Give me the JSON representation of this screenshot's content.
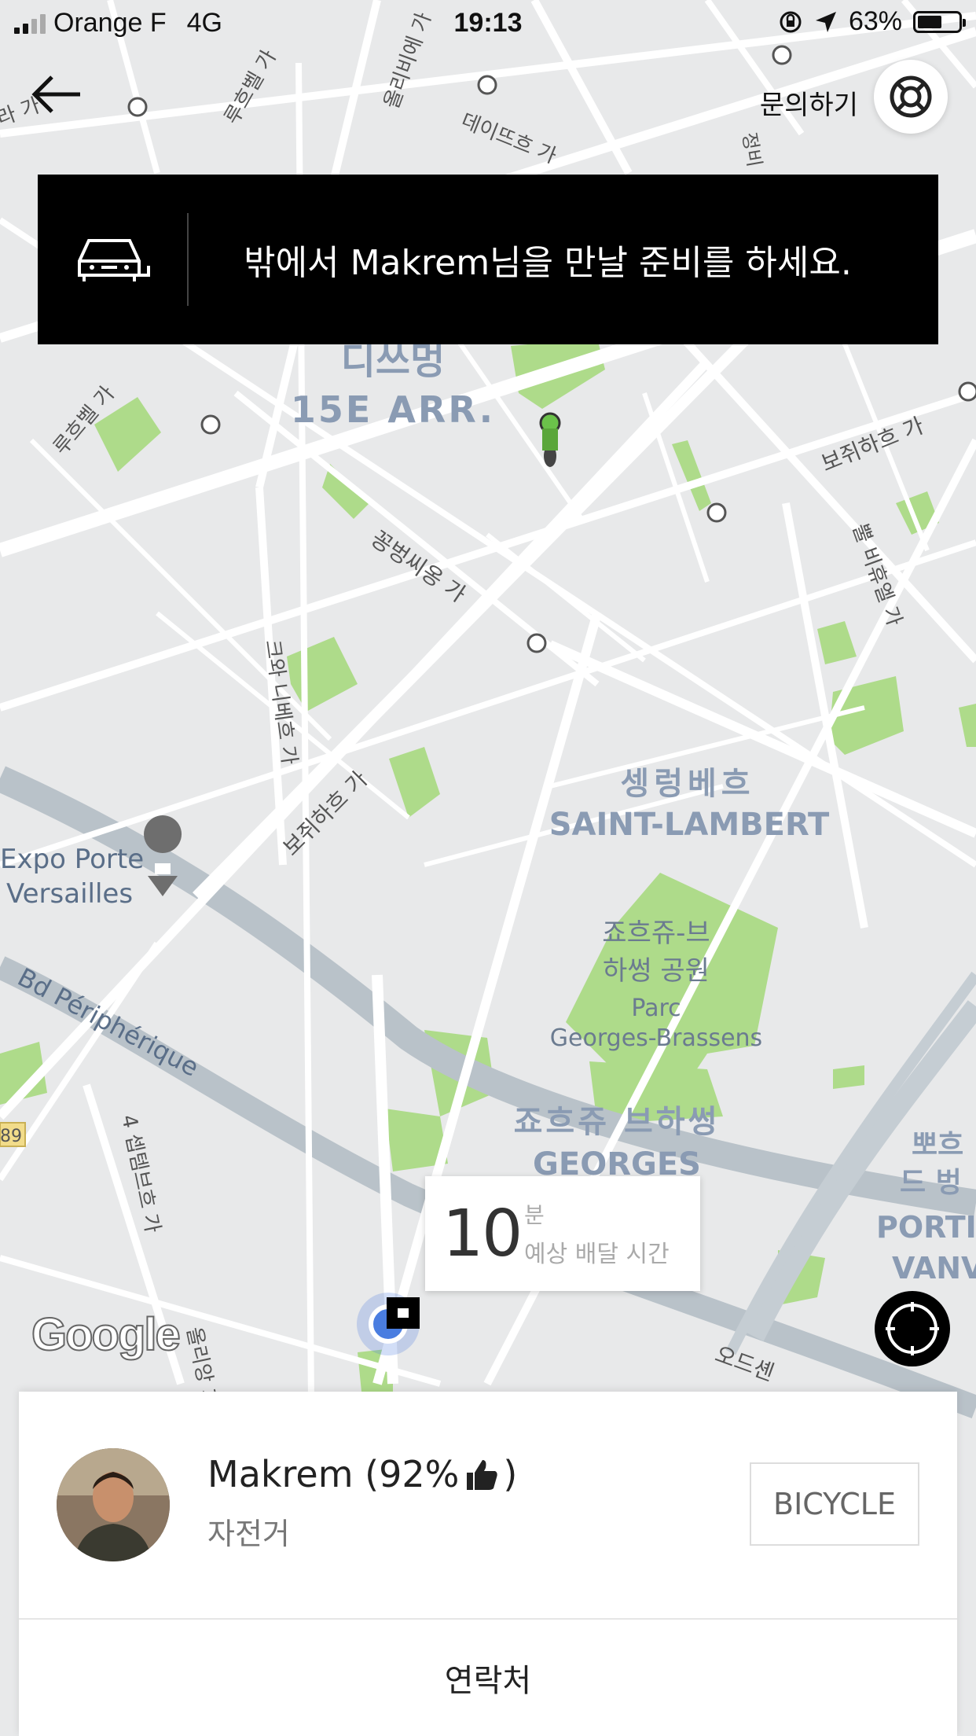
{
  "status_bar": {
    "carrier": "Orange F",
    "network": "4G",
    "time": "19:13",
    "battery": "63%",
    "battery_level": 0.63
  },
  "header": {
    "help_label": "문의하기"
  },
  "banner": {
    "message": "밖에서 Makrem님을 만날 준비를 하세요."
  },
  "map": {
    "labels": {
      "district_ko": "디쓰멍",
      "district": "15E ARR.",
      "st_lambert_ko": "셍렁베흐",
      "st_lambert": "SAINT-LAMBERT",
      "parc_ko_1": "죠흐쥬-브",
      "parc_ko_2": "하썽 공원",
      "parc_1": "Parc",
      "parc_2": "Georges-Brassens",
      "georges_ko": "죠흐쥬 브하썽",
      "georges": "GEORGES",
      "expo_1": "Expo Porte",
      "expo_2": "Versailles",
      "periph": "Bd Périphérique",
      "vaugirard_1": "보쥐하흐 가",
      "vaugirard_2": "보쥐하흐 가",
      "convention": "꽁벙씨옹 가",
      "lecourbe_1": "루흐벨 가",
      "lecourbe_2": "루흐벨 가",
      "olivier": "올리비에 가",
      "desnouettes": "데이뜨흐 가",
      "blomet": "크와 니베흐 가",
      "brancion": "뿔 비휴엘 가",
      "porte_ko_1": "뽀흐",
      "porte_ko_2": "드 벙",
      "porte_1": "PORTI",
      "porte_2": "VANV",
      "four": "4 셉템브흐 가",
      "odessa": "오드셴",
      "ra": "라 가",
      "ol": "올리앙 가",
      "jeong": "정비",
      "road_num": "89"
    }
  },
  "eta": {
    "minutes": "10",
    "unit": "분",
    "label": "예상 배달 시간"
  },
  "courier": {
    "name": "Makrem (92%",
    "close_paren": ")",
    "vehicle": "자전거",
    "vehicle_badge": "BICYCLE"
  },
  "footer": {
    "contact_label": "연락처"
  },
  "map_attribution": "Google",
  "colors": {
    "map_bg": "#e8e9ea",
    "road": "#ffffff",
    "park": "#aedb8a",
    "highway": "#b9c2c9",
    "banner_bg": "#000000",
    "label_blue": "#8a9bb3"
  }
}
